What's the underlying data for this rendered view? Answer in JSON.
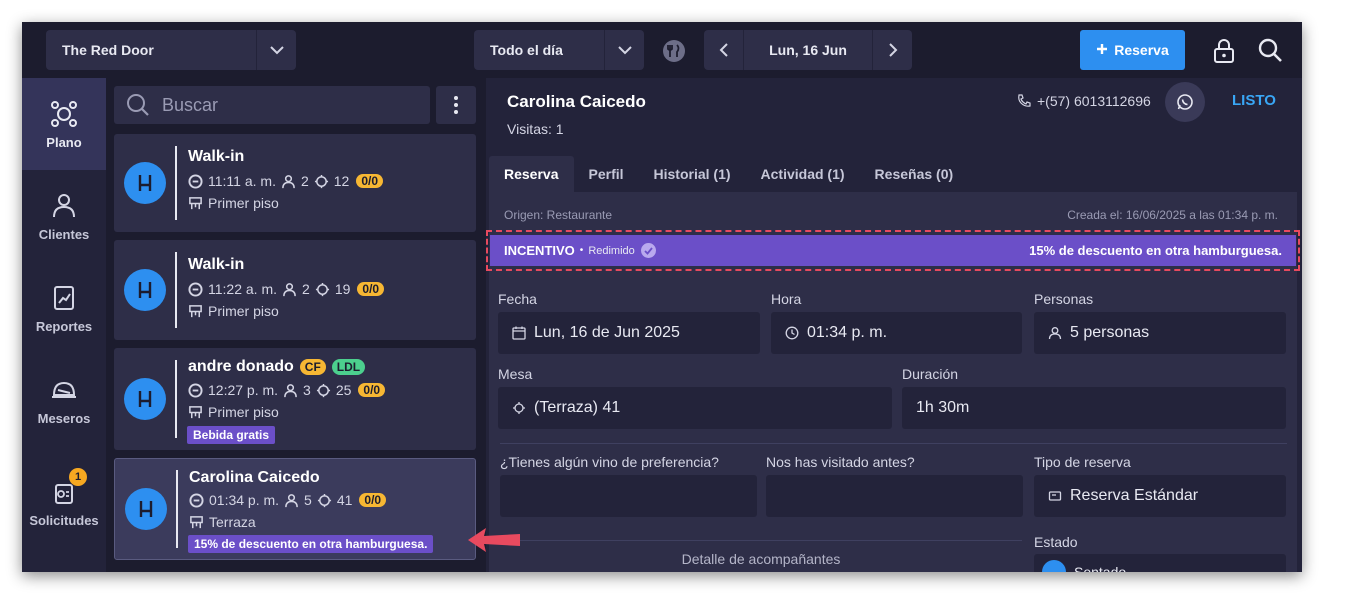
{
  "topbar": {
    "restaurant": "The Red Door",
    "period": "Todo el día",
    "date": "Lun, 16 Jun",
    "new_reservation": "Reserva"
  },
  "nav": {
    "items": [
      {
        "label": "Plano",
        "icon": "floor-plan-icon",
        "active": true
      },
      {
        "label": "Clientes",
        "icon": "user-icon"
      },
      {
        "label": "Reportes",
        "icon": "reports-icon"
      },
      {
        "label": "Meseros",
        "icon": "waiter-icon"
      },
      {
        "label": "Solicitudes",
        "icon": "requests-icon",
        "badge": "1"
      }
    ]
  },
  "list": {
    "search_placeholder": "Buscar",
    "cards": [
      {
        "name": "Walk-in",
        "time": "11:11 a. m.",
        "guests": "2",
        "table": "12",
        "status": "0/0",
        "area": "Primer piso"
      },
      {
        "name": "Walk-in",
        "time": "11:22 a. m.",
        "guests": "2",
        "table": "19",
        "status": "0/0",
        "area": "Primer piso"
      },
      {
        "name": "andre donado",
        "badges": [
          "CF",
          "LDL"
        ],
        "time": "12:27 p. m.",
        "guests": "3",
        "table": "25",
        "status": "0/0",
        "area": "Primer piso",
        "tag": "Bebida gratis"
      },
      {
        "name": "Carolina Caicedo",
        "time": "01:34 p. m.",
        "guests": "5",
        "table": "41",
        "status": "0/0",
        "area": "Terraza",
        "tag": "15% de descuento en otra hamburguesa."
      }
    ]
  },
  "detail": {
    "name": "Carolina Caicedo",
    "visits": "Visitas: 1",
    "phone": "+(57) 6013112696",
    "status_button": "LISTO",
    "tabs": [
      "Reserva",
      "Perfil",
      "Historial (1)",
      "Actividad (1)",
      "Reseñas (0)"
    ],
    "origin": "Origen: Restaurante",
    "created": "Creada el: 16/06/2025 a las 01:34 p. m.",
    "incentive": {
      "label": "INCENTIVO",
      "state": "Redimido",
      "description": "15% de descuento en otra hamburguesa."
    },
    "fields": {
      "fecha_label": "Fecha",
      "fecha": "Lun, 16 de Jun 2025",
      "hora_label": "Hora",
      "hora": "01:34 p. m.",
      "personas_label": "Personas",
      "personas": "5 personas",
      "mesa_label": "Mesa",
      "mesa": "(Terraza) 41",
      "duracion_label": "Duración",
      "duracion": "1h 30m",
      "vino_label": "¿Tienes algún vino de preferencia?",
      "visitado_label": "Nos has visitado antes?",
      "tipo_label": "Tipo de reserva",
      "tipo": "Reserva Estándar",
      "estado_label": "Estado",
      "estado": "Sentado"
    },
    "companions": "Detalle de acompañantes"
  },
  "colors": {
    "accent": "#2d8ff0",
    "incentive": "#6b4fc8",
    "highlight": "#e84a5f",
    "pill": "#f7b733"
  }
}
